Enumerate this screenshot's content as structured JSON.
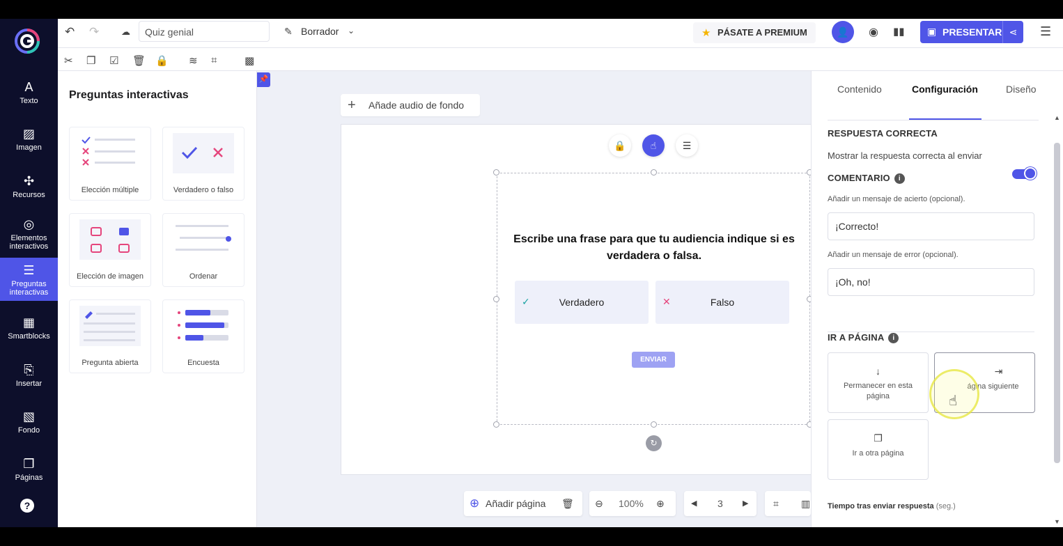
{
  "nav": {
    "items": [
      {
        "label": "Texto",
        "icon": "A"
      },
      {
        "label": "Imagen",
        "icon": "▨"
      },
      {
        "label": "Recursos",
        "icon": "✣"
      },
      {
        "label": "Elementos interactivos",
        "icon": "◎"
      },
      {
        "label": "Preguntas interactivas",
        "icon": "☰"
      },
      {
        "label": "Smartblocks",
        "icon": "▦"
      },
      {
        "label": "Insertar",
        "icon": "⎘"
      },
      {
        "label": "Fondo",
        "icon": "▧"
      },
      {
        "label": "Páginas",
        "icon": "❐"
      }
    ],
    "help": "?"
  },
  "topbar": {
    "doc_name": "Quiz genial",
    "status": "Borrador",
    "premium": "PÁSATE A PREMIUM",
    "present": "PRESENTAR"
  },
  "panel": {
    "title": "Preguntas interactivas",
    "cards": [
      "Elección múltiple",
      "Verdadero o falso",
      "Elección de imagen",
      "Ordenar",
      "Pregunta abierta",
      "Encuesta"
    ]
  },
  "canvas": {
    "audio": "Añade audio de fondo",
    "question": "Escribe una frase para que tu audiencia indique si es verdadera o falsa.",
    "option_true": "Verdadero",
    "option_false": "Falso",
    "submit": "ENVIAR"
  },
  "bottombar": {
    "add_page": "Añadir página",
    "zoom": "100%",
    "page": "3"
  },
  "config": {
    "tabs": [
      "Contenido",
      "Configuración",
      "Diseño"
    ],
    "active_tab": "Configuración",
    "correct_heading": "RESPUESTA CORRECTA",
    "show_correct": "Mostrar la respuesta correcta al enviar",
    "show_correct_on": true,
    "comment_heading": "COMENTARIO",
    "success_label": "Añadir un mensaje de acierto (opcional).",
    "success_value": "¡Correcto!",
    "error_label": "Añadir un mensaje de error (opcional).",
    "error_value": "¡Oh, no!",
    "goto_heading": "IR A PÁGINA",
    "goto_options": [
      "Permanecer en esta página",
      "Página siguiente",
      "Ir a otra página"
    ],
    "goto_next_visible": "ágina siguiente",
    "time_label": "Tiempo tras enviar respuesta",
    "time_unit": "(seg.)"
  },
  "colors": {
    "accent": "#4f55e7",
    "nav_bg": "#0d0f2b",
    "check": "#1aa3a3",
    "cross": "#e5457c"
  }
}
